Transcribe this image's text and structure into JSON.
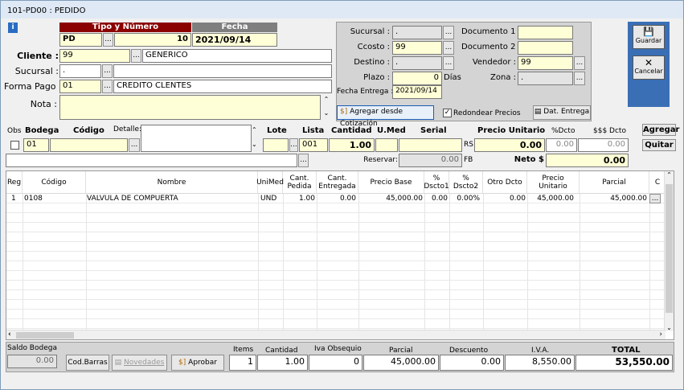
{
  "window": {
    "title": "101-PD00 : PEDIDO"
  },
  "header": {
    "tipo_numero_label": "Tipo y Número",
    "fecha_label": "Fecha",
    "tipo": "PD",
    "numero": "10",
    "fecha": "2021/09/14",
    "cliente_label": "Cliente :",
    "cliente_code": "99",
    "cliente_name": "GENERICO",
    "sucursal_label": "Sucursal :",
    "sucursal_code": ".",
    "sucursal_name": "",
    "forma_pago_label": "Forma Pago :",
    "forma_pago_code": "01",
    "forma_pago_name": "CREDITO CLENTES",
    "nota_label": "Nota :",
    "nota": ""
  },
  "right_panel": {
    "sucursal_label": "Sucursal :",
    "sucursal_value": ".",
    "ccosto_label": "Ccosto :",
    "ccosto_value": "99",
    "destino_label": "Destino :",
    "destino_value": ".",
    "plazo_label": "Plazo :",
    "plazo_value": "0",
    "dias_label": "Días",
    "fecha_entrega_label": "Fecha Entrega :",
    "fecha_entrega_value": "2021/09/14",
    "documento1_label": "Documento 1 :",
    "documento1_value": "",
    "documento2_label": "Documento 2 :",
    "documento2_value": "",
    "vendedor_label": "Vendedor :",
    "vendedor_value": "99",
    "zona_label": "Zona :",
    "zona_value": ".",
    "agregar_cotizacion_label": "Agregar desde Cotización",
    "redondear_label": "Redondear Precios",
    "dat_entrega_label": "Dat. Entrega"
  },
  "side": {
    "guardar": "Guardar",
    "cancelar": "Cancelar"
  },
  "entry": {
    "obs_label": "Obs",
    "bodega_label": "Bodega",
    "codigo_label": "Código",
    "detalle_label": "Detalle:",
    "lote_label": "Lote",
    "lista_label": "Lista",
    "cantidad_label": "Cantidad",
    "umed_label": "U.Med",
    "serial_label": "Serial",
    "precio_unitario_label": "Precio Unitario",
    "pdcto_label": "%Dcto",
    "sdcto_label": "$$$ Dcto",
    "bodega_value": "01",
    "codigo_value": "",
    "lote_value": "",
    "lista_value": "001",
    "cantidad_value": "1.00",
    "umed_value": "",
    "serial_value": "",
    "rs_label": "RS",
    "precio_value": "0.00",
    "pdcto_value": "0.00",
    "sdcto_value": "0.00",
    "reservar_label": "Reservar:",
    "reservar_value": "0.00",
    "fb_label": "FB",
    "neto_label": "Neto $",
    "neto_value": "0.00",
    "agregar": "Agregar",
    "quitar": "Quitar"
  },
  "grid": {
    "columns": [
      "Reg",
      "Código",
      "Nombre",
      "UniMed",
      "Cant. Pedida",
      "Cant. Entregada",
      "Precio Base",
      "% Dscto1",
      "% Dscto2",
      "Otro Dcto",
      "Precio Unitario",
      "Parcial",
      "C"
    ],
    "rows": [
      {
        "reg": "1",
        "codigo": "0108",
        "nombre": "VALVULA DE COMPUERTA",
        "unimed": "UND",
        "pedida": "1.00",
        "entregada": "0.00",
        "precio_base": "45,000.00",
        "dscto1": "0.00",
        "dscto2": "0.00%",
        "otro": "0.00",
        "precio_unit": "45,000.00",
        "parcial": "45,000.00"
      }
    ]
  },
  "footer": {
    "saldo_bodega_label": "Saldo Bodega",
    "saldo_bodega_value": "0.00",
    "cod_barras": "Cod.Barras",
    "novedades": "Novedades",
    "aprobar": "Aprobar",
    "items_label": "Items",
    "items_value": "1",
    "cantidad_label": "Cantidad",
    "cantidad_value": "1.00",
    "iva_obsequio_label": "Iva Obsequio",
    "iva_obsequio_value": "0",
    "parcial_label": "Parcial",
    "parcial_value": "45,000.00",
    "descuento_label": "Descuento",
    "descuento_value": "0.00",
    "iva_label": "I.V.A.",
    "iva_value": "8,550.00",
    "total_label": "TOTAL",
    "total_value": "53,550.00"
  }
}
